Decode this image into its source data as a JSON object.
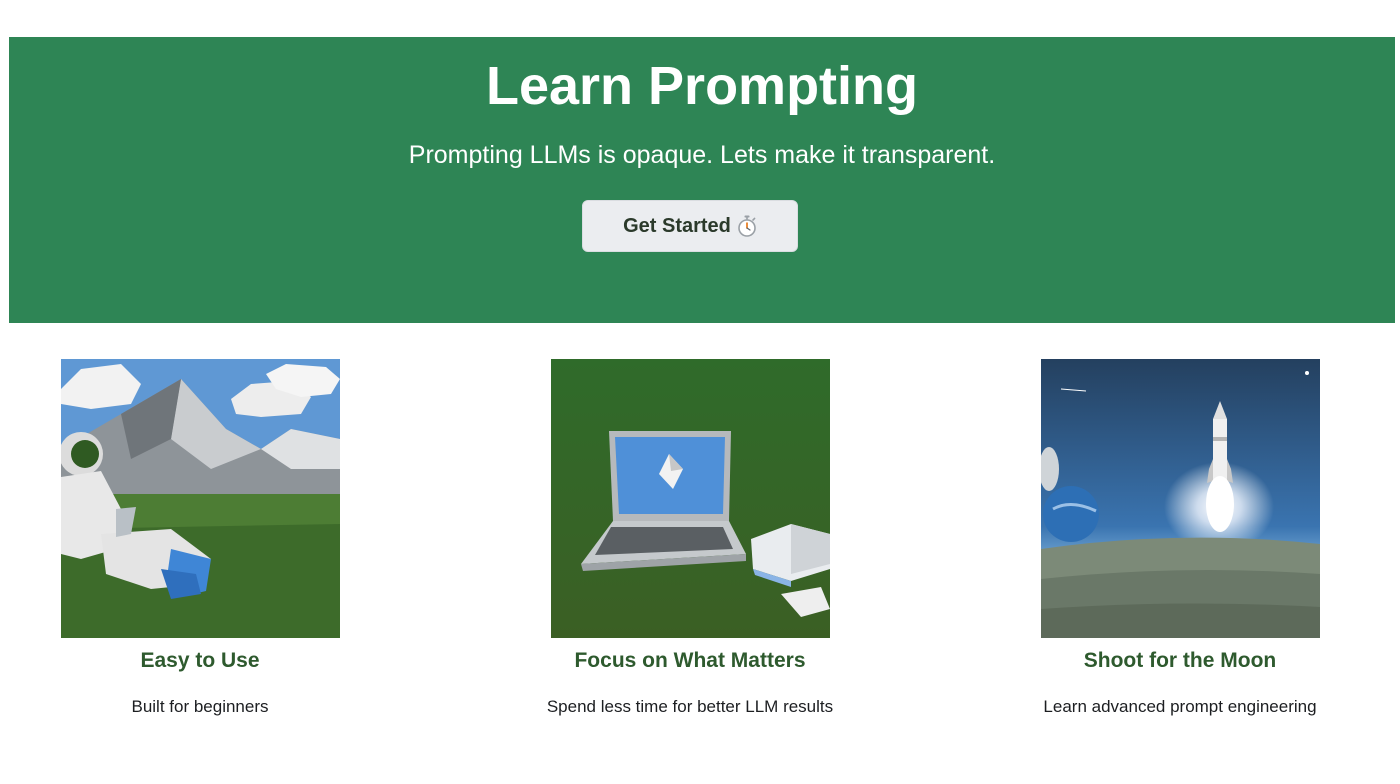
{
  "hero": {
    "title": "Learn Prompting",
    "subtitle": "Prompting LLMs is opaque. Lets make it transparent.",
    "cta_label": "Get Started",
    "cta_icon": "stopwatch-icon",
    "background_color": "#2e8555"
  },
  "features": [
    {
      "title": "Easy to Use",
      "description": "Built for beginners",
      "image": "astronaut-in-meadow-image"
    },
    {
      "title": "Focus on What Matters",
      "description": "Spend less time for better LLM results",
      "image": "laptop-on-grass-image"
    },
    {
      "title": "Shoot for the Moon",
      "description": "Learn advanced prompt engineering",
      "image": "rocket-launch-image"
    }
  ]
}
